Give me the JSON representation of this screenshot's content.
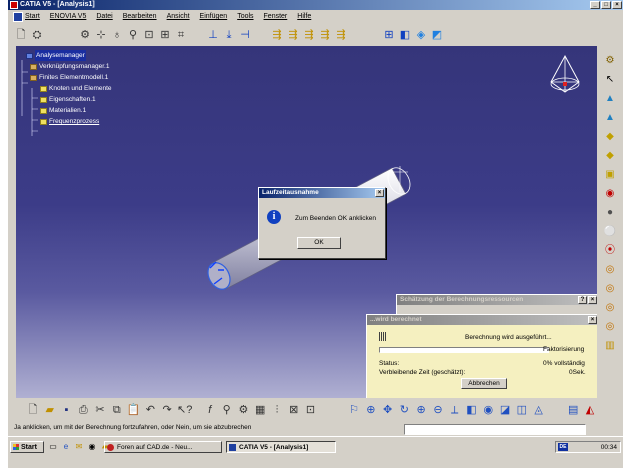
{
  "window": {
    "title": "CATIA V5 - [Analysis1]",
    "buttons": [
      "_",
      "□",
      "×"
    ]
  },
  "menu": {
    "items": [
      "Start",
      "ENOVIA V5",
      "Datei",
      "Bearbeiten",
      "Ansicht",
      "Einfügen",
      "Tools",
      "Fenster",
      "Hilfe"
    ]
  },
  "tree": {
    "nodes": [
      {
        "label": "Analysemanager",
        "level": 0
      },
      {
        "label": "Verknüpfungsmanager.1",
        "level": 0
      },
      {
        "label": "Finites Elementmodell.1",
        "level": 0
      },
      {
        "label": "Knoten und Elemente",
        "level": 1
      },
      {
        "label": "Eigenschaften.1",
        "level": 1
      },
      {
        "label": "Materialien.1",
        "level": 1
      },
      {
        "label": "Frequenzprozess",
        "level": 1
      }
    ]
  },
  "dialog_runtime": {
    "title": "Laufzeitausnahme",
    "message": "Zum Beenden OK anklicken",
    "ok": "OK",
    "close": "×"
  },
  "dialog_estimate": {
    "title": "Schätzung der Berechnungsressourcen",
    "help": "?",
    "close": "×"
  },
  "dialog_calc": {
    "title": "...wird berechnet",
    "close": "×",
    "message": "Berechnung wird ausgeführt...",
    "phase": "Faktorisierung",
    "status_label": "Status:",
    "status_value": "0% vollständig",
    "remaining_label": "Verbleibende Zeit (geschätzt):",
    "remaining_value": "0Sek.",
    "cancel": "Abbrechen",
    "progress": 0.0
  },
  "status_bar": {
    "text": "Ja anklicken, um mit der Berechnung fortzufahren, oder Nein, um sie abzubrechen"
  },
  "taskbar": {
    "start": "Start",
    "tasks": [
      "Foren auf CAD.de - Neu...",
      "CATIA V5 - [Analysis1]"
    ],
    "clock": "00:34",
    "lang": "DE"
  },
  "colors": {
    "title_active": "#0a246a",
    "viewport_top": "#35357a",
    "viewport_bottom": "#b0b0d2",
    "calc_dialog_bg": "#f5f0c0"
  }
}
